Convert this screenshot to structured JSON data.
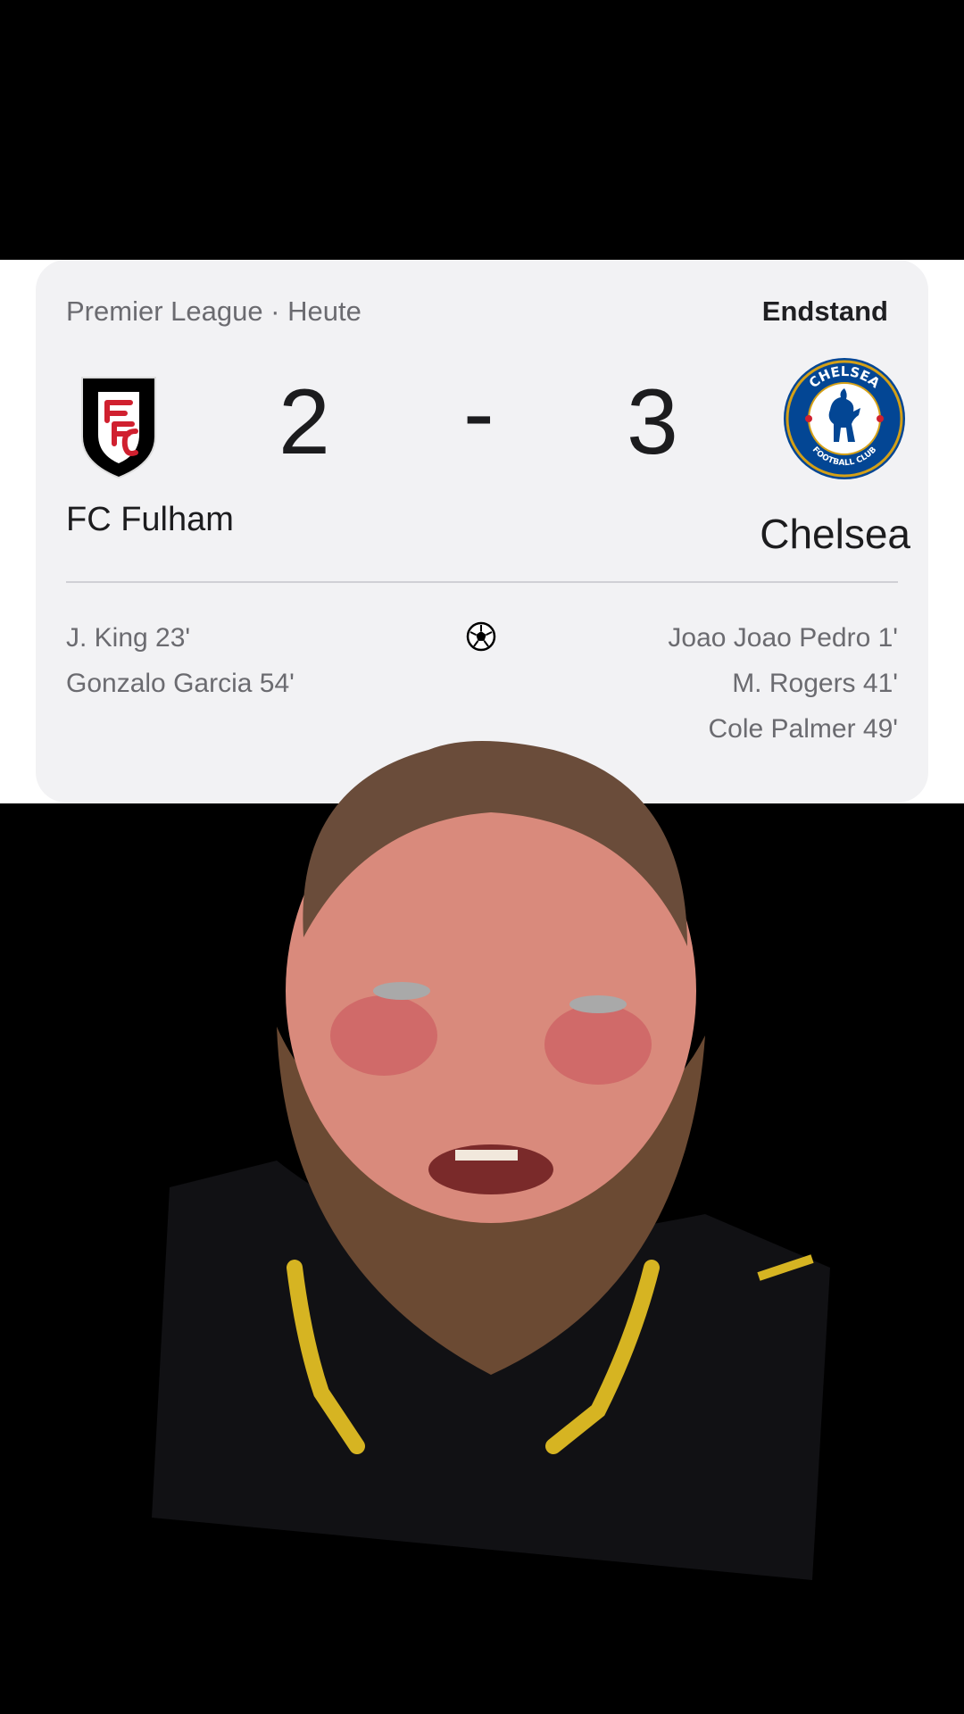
{
  "match_card": {
    "competition_date": "Premier League · Heute",
    "status": "Endstand",
    "home": {
      "name": "FC Fulham",
      "score": "2",
      "crest_icon": "fulham-crest-icon",
      "scorers": [
        "J. King 23'",
        "Gonzalo Garcia 54'"
      ]
    },
    "separator": "-",
    "away": {
      "name": "Chelsea",
      "score": "3",
      "crest_icon": "chelsea-crest-icon",
      "crest_text_top": "CHELSEA",
      "crest_text_bottom": "FOOTBALL CLUB",
      "scorers": [
        "Joao Joao Pedro 1'",
        "M. Rogers 41'",
        "Cole Palmer 49'"
      ]
    },
    "goal_icon": "soccer-ball-icon"
  },
  "colors": {
    "card_background": "#f2f2f4",
    "fulham_red": "#d0202f",
    "chelsea_blue": "#034694",
    "page_background": "#000000"
  }
}
